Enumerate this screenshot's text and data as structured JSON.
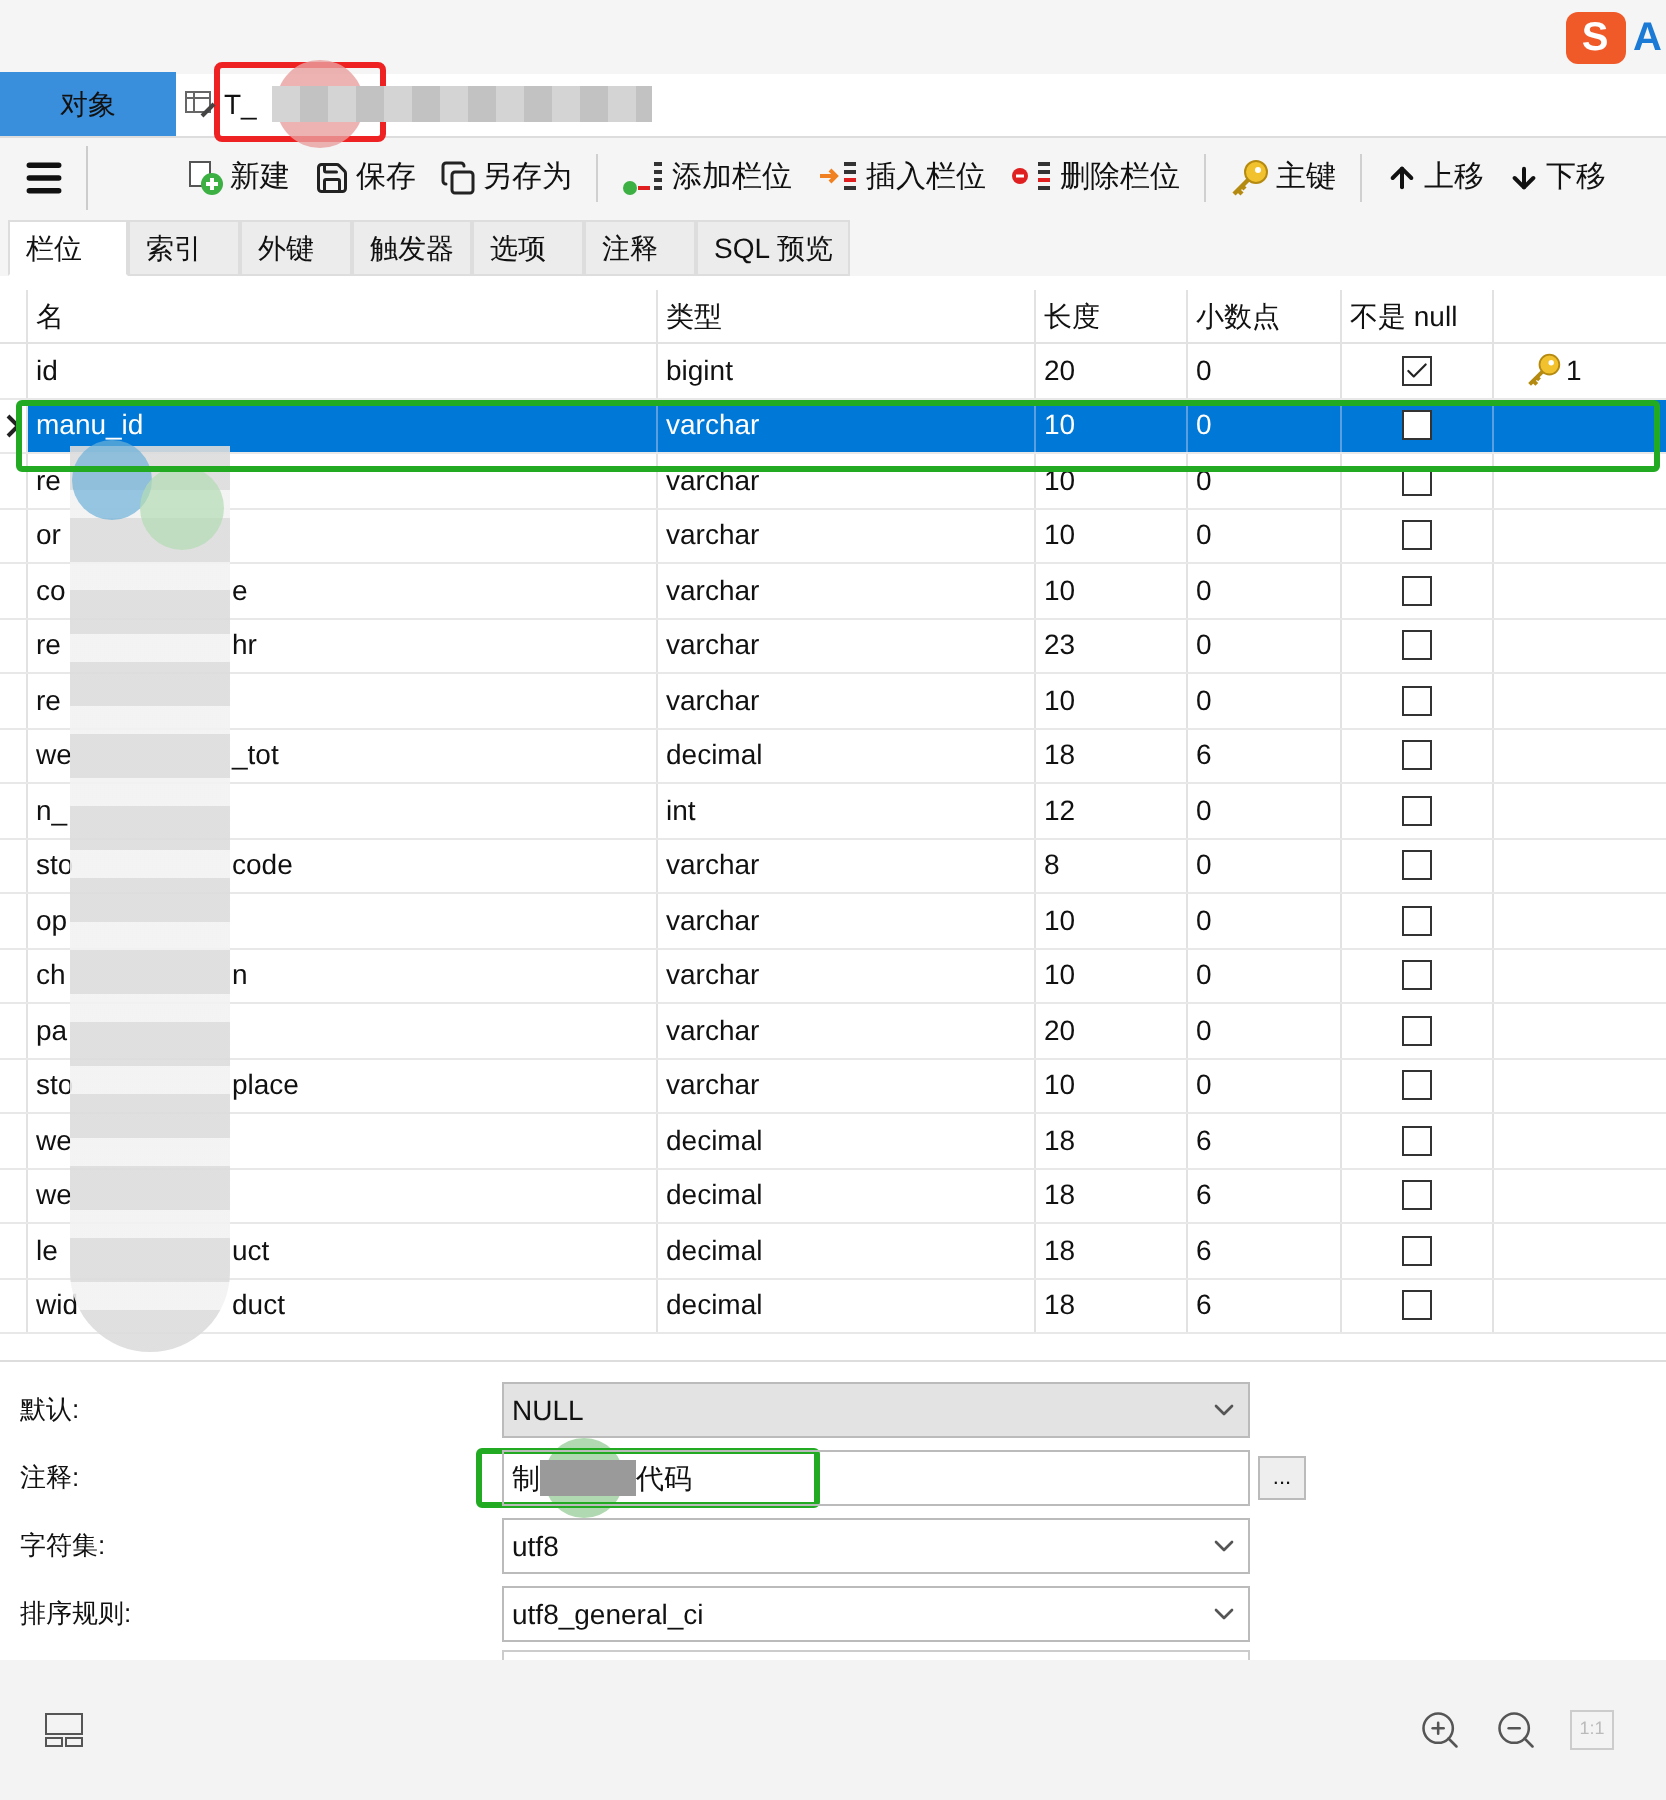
{
  "object_tabs": [
    {
      "label": "对象",
      "selected": true,
      "kind": "plain"
    },
    {
      "label": "T_",
      "selected": false,
      "kind": "table",
      "redacted": true
    }
  ],
  "toolbar": [
    {
      "label": "新建",
      "kind": "new"
    },
    {
      "label": "保存",
      "kind": "save"
    },
    {
      "label": "另存为",
      "kind": "saveas"
    },
    {
      "label": "添加栏位",
      "kind": "addcol"
    },
    {
      "label": "插入栏位",
      "kind": "insertcol"
    },
    {
      "label": "删除栏位",
      "kind": "deletecol"
    },
    {
      "label": "主键",
      "kind": "key"
    },
    {
      "label": "上移",
      "kind": "up"
    },
    {
      "label": "下移",
      "kind": "down"
    }
  ],
  "sub_tabs": [
    {
      "label": "栏位",
      "selected": true
    },
    {
      "label": "索引",
      "selected": false
    },
    {
      "label": "外键",
      "selected": false
    },
    {
      "label": "触发器",
      "selected": false
    },
    {
      "label": "选项",
      "selected": false
    },
    {
      "label": "注释",
      "selected": false
    },
    {
      "label": "SQL 预览",
      "selected": false
    }
  ],
  "table": {
    "columns": [
      "名",
      "类型",
      "长度",
      "小数点",
      "不是 null"
    ],
    "rows": [
      {
        "name_start": "id",
        "name_end": "",
        "type": "bigint",
        "length": "20",
        "decimals": "0",
        "not_null": true,
        "key": "1",
        "selected": false
      },
      {
        "name_start": "manu_id",
        "name_end": "",
        "type": "varchar",
        "length": "10",
        "decimals": "0",
        "not_null": false,
        "selected": true
      },
      {
        "name_start": "re",
        "name_end": "",
        "type": "varchar",
        "length": "10",
        "decimals": "0",
        "not_null": false,
        "selected": false
      },
      {
        "name_start": "or",
        "name_end": "",
        "type": "varchar",
        "length": "10",
        "decimals": "0",
        "not_null": false,
        "selected": false
      },
      {
        "name_start": "co",
        "name_end": "e",
        "type": "varchar",
        "length": "10",
        "decimals": "0",
        "not_null": false,
        "selected": false
      },
      {
        "name_start": "re",
        "name_end": "hr",
        "type": "varchar",
        "length": "23",
        "decimals": "0",
        "not_null": false,
        "selected": false
      },
      {
        "name_start": "re",
        "name_end": "",
        "type": "varchar",
        "length": "10",
        "decimals": "0",
        "not_null": false,
        "selected": false
      },
      {
        "name_start": "we",
        "name_end": "_tot",
        "type": "decimal",
        "length": "18",
        "decimals": "6",
        "not_null": false,
        "selected": false
      },
      {
        "name_start": "n_",
        "name_end": "",
        "type": "int",
        "length": "12",
        "decimals": "0",
        "not_null": false,
        "selected": false
      },
      {
        "name_start": "sto",
        "name_end": "code",
        "type": "varchar",
        "length": "8",
        "decimals": "0",
        "not_null": false,
        "selected": false
      },
      {
        "name_start": "op",
        "name_end": "",
        "type": "varchar",
        "length": "10",
        "decimals": "0",
        "not_null": false,
        "selected": false
      },
      {
        "name_start": "ch",
        "name_end": "n",
        "type": "varchar",
        "length": "10",
        "decimals": "0",
        "not_null": false,
        "selected": false
      },
      {
        "name_start": "pa",
        "name_end": "",
        "type": "varchar",
        "length": "20",
        "decimals": "0",
        "not_null": false,
        "selected": false
      },
      {
        "name_start": "sto",
        "name_end": "place",
        "type": "varchar",
        "length": "10",
        "decimals": "0",
        "not_null": false,
        "selected": false
      },
      {
        "name_start": "we",
        "name_end": "",
        "type": "decimal",
        "length": "18",
        "decimals": "6",
        "not_null": false,
        "selected": false
      },
      {
        "name_start": "we",
        "name_end": "",
        "type": "decimal",
        "length": "18",
        "decimals": "6",
        "not_null": false,
        "selected": false
      },
      {
        "name_start": "le",
        "name_end": "uct",
        "type": "decimal",
        "length": "18",
        "decimals": "6",
        "not_null": false,
        "selected": false
      },
      {
        "name_start": "wid",
        "name_end": "duct",
        "type": "decimal",
        "length": "18",
        "decimals": "6",
        "not_null": false,
        "selected": false
      }
    ]
  },
  "properties": [
    {
      "label": "默认:",
      "value": "NULL",
      "kind": "dropdown",
      "disabled": true
    },
    {
      "label": "注释:",
      "value_start": "制",
      "value_end": "代码",
      "kind": "text"
    },
    {
      "label": "字符集:",
      "value": "utf8",
      "kind": "dropdown",
      "disabled": false
    },
    {
      "label": "排序规则:",
      "value": "utf8_general_ci",
      "kind": "dropdown",
      "disabled": false
    }
  ],
  "comment_button": "...",
  "ime_logo": {
    "letter": "S",
    "next": "A"
  },
  "zoom_reset": "1:1"
}
